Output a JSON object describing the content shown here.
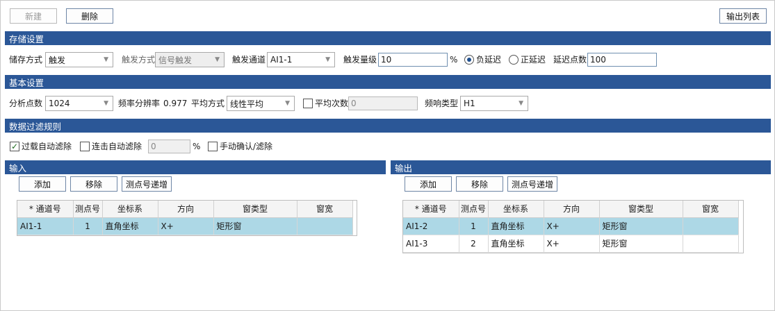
{
  "toolbar": {
    "new": "新建",
    "delete": "删除",
    "output_list": "输出列表"
  },
  "storage": {
    "title": "存储设置",
    "save_mode_label": "储存方式",
    "save_mode": "触发",
    "trigger_mode_label": "触发方式",
    "trigger_mode": "信号触发",
    "trigger_channel_label": "触发通道",
    "trigger_channel": "AI1-1",
    "trigger_level_label": "触发量级",
    "trigger_level": "10",
    "trigger_level_unit": "%",
    "neg_delay_label": "负延迟",
    "pos_delay_label": "正延迟",
    "delay_points_label": "延迟点数",
    "delay_points": "100"
  },
  "basic": {
    "title": "基本设置",
    "points_label": "分析点数",
    "points": "1024",
    "freq_res_label": "频率分辨率",
    "freq_res": "0.977",
    "avg_mode_label": "平均方式",
    "avg_mode": "线性平均",
    "avg_count_label": "平均次数",
    "avg_count": "0",
    "freq_type_label": "频响类型",
    "freq_type": "H1"
  },
  "filter": {
    "title": "数据过滤规则",
    "overload_label": "过载自动滤除",
    "burst_label": "连击自动滤除",
    "burst_value": "0",
    "burst_unit": "%",
    "manual_label": "手动确认/滤除"
  },
  "input": {
    "title": "输入",
    "add": "添加",
    "remove": "移除",
    "increment": "测点号递增",
    "columns": [
      "* 通道号",
      "测点号",
      "坐标系",
      "方向",
      "窗类型",
      "窗宽"
    ],
    "rows": [
      [
        "AI1-1",
        "1",
        "直角坐标",
        "X+",
        "矩形窗",
        ""
      ]
    ]
  },
  "output": {
    "title": "输出",
    "add": "添加",
    "remove": "移除",
    "increment": "测点号递增",
    "columns": [
      "* 通道号",
      "测点号",
      "坐标系",
      "方向",
      "窗类型",
      "窗宽"
    ],
    "rows": [
      [
        "AI1-2",
        "1",
        "直角坐标",
        "X+",
        "矩形窗",
        ""
      ],
      [
        "AI1-3",
        "2",
        "直角坐标",
        "X+",
        "矩形窗",
        ""
      ]
    ]
  },
  "icons": {
    "dropdown": "chevron-down-icon",
    "check": "check-icon"
  }
}
